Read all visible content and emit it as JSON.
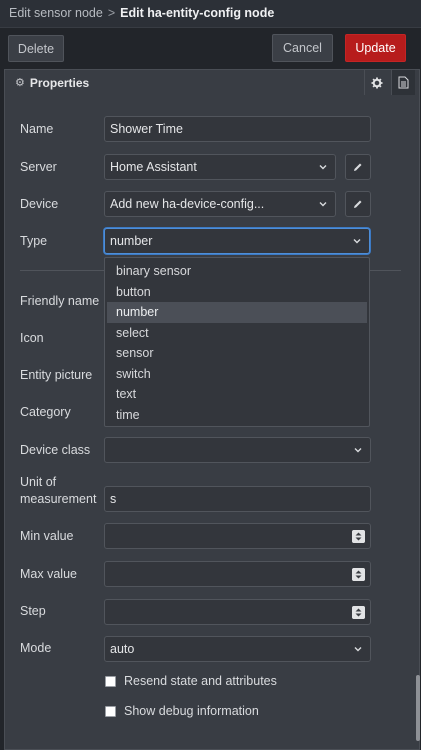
{
  "breadcrumb": {
    "parent": "Edit sensor node",
    "separator": ">",
    "current": "Edit ha-entity-config node"
  },
  "toolbar": {
    "delete_label": "Delete",
    "cancel_label": "Cancel",
    "update_label": "Update",
    "update_color": "#b71c1c"
  },
  "tabs": {
    "properties_label": "Properties",
    "properties_icon": "gear-icon",
    "settings_icon": "gear-icon",
    "description_icon": "document-icon"
  },
  "form": {
    "name": {
      "label": "Name",
      "value": "Shower Time"
    },
    "server": {
      "label": "Server",
      "value": "Home Assistant"
    },
    "device": {
      "label": "Device",
      "value": "Add new ha-device-config..."
    },
    "type": {
      "label": "Type",
      "value": "number"
    },
    "friendly_name": {
      "label": "Friendly name"
    },
    "icon": {
      "label": "Icon"
    },
    "entity_picture": {
      "label": "Entity picture"
    },
    "category": {
      "label": "Category"
    },
    "device_class": {
      "label": "Device class",
      "value": ""
    },
    "unit": {
      "label_line1": "Unit of",
      "label_line2": "measurement",
      "value": "s"
    },
    "min_value": {
      "label": "Min value",
      "value": ""
    },
    "max_value": {
      "label": "Max value",
      "value": ""
    },
    "step": {
      "label": "Step",
      "value": ""
    },
    "mode": {
      "label": "Mode",
      "value": "auto"
    },
    "resend": {
      "label": "Resend state and attributes",
      "checked": false
    },
    "debug": {
      "label": "Show debug information",
      "checked": false
    }
  },
  "type_dropdown": {
    "options": [
      "binary sensor",
      "button",
      "number",
      "select",
      "sensor",
      "switch",
      "text",
      "time"
    ],
    "selected": "number"
  },
  "colors": {
    "accent_focus": "#4e8ed8",
    "background": "#22252a",
    "panel": "#393d44"
  }
}
